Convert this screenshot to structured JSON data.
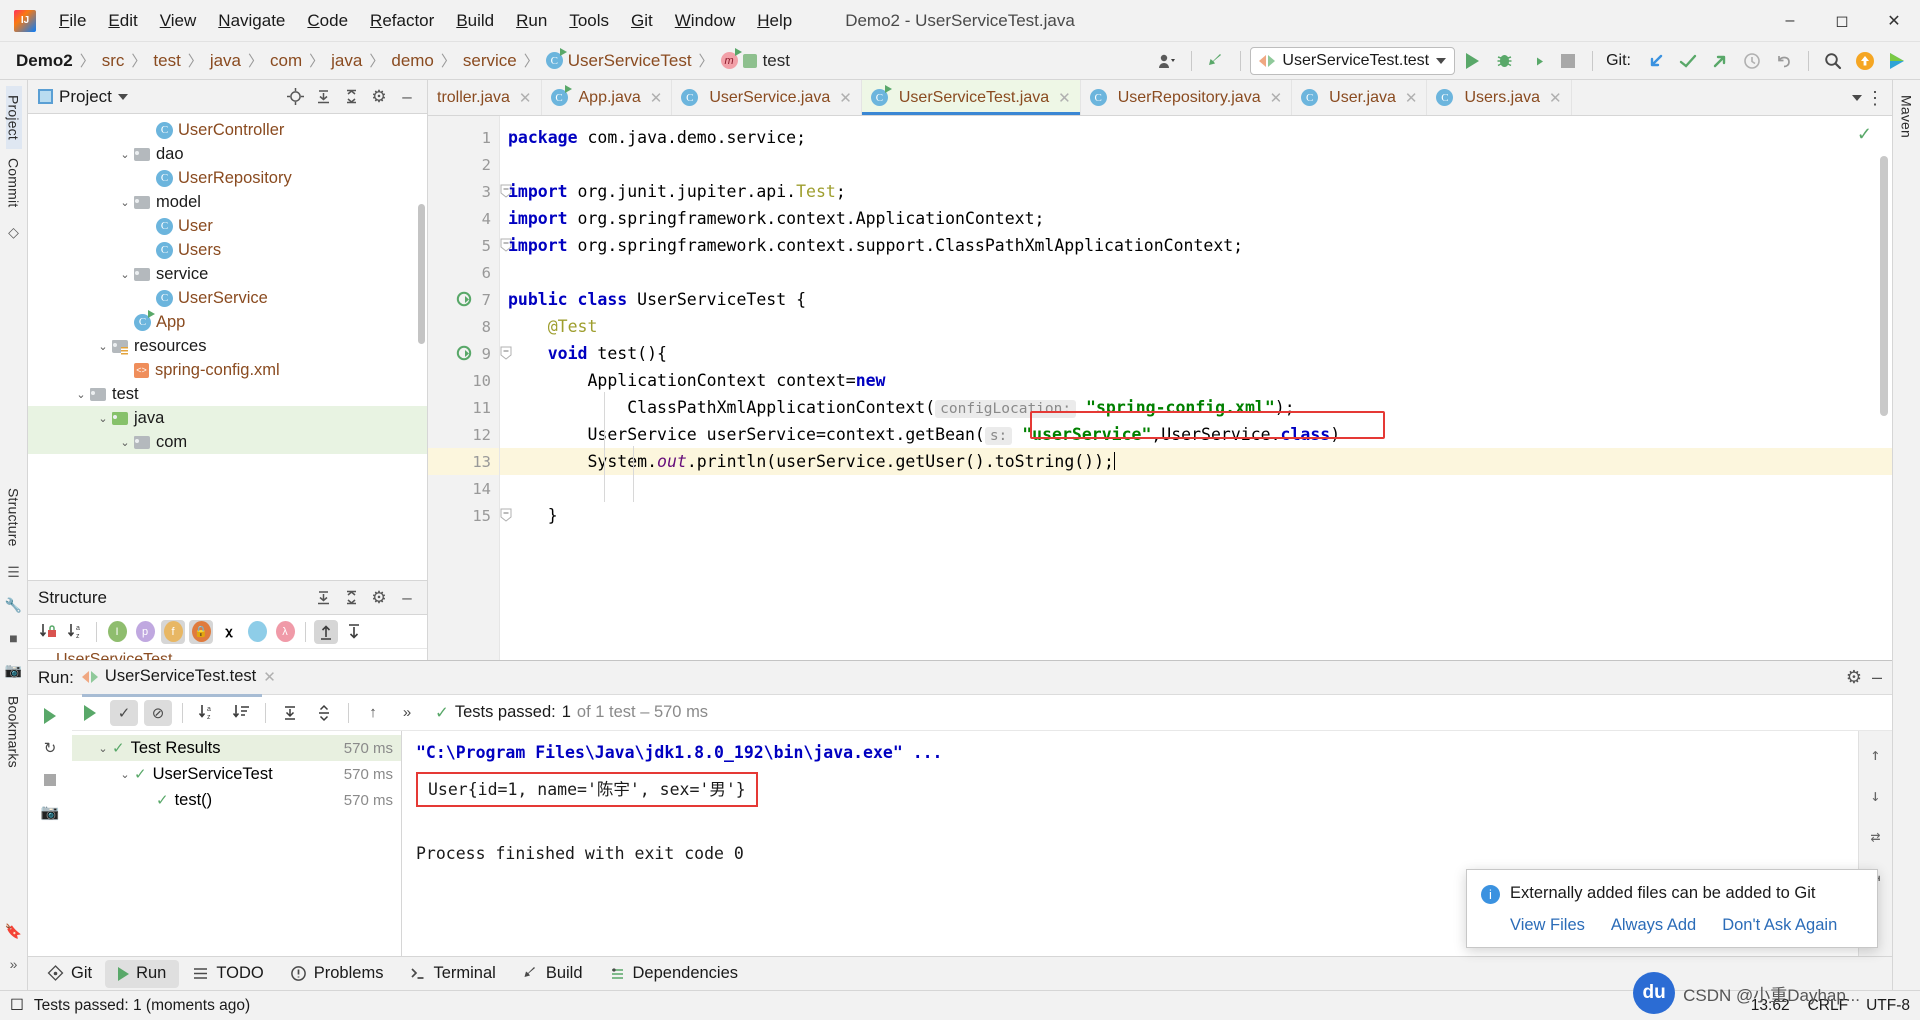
{
  "window": {
    "title": "Demo2 - UserServiceTest.java",
    "minimize": "─",
    "maximize": "☐",
    "close": "✕"
  },
  "menu": [
    "File",
    "Edit",
    "View",
    "Navigate",
    "Code",
    "Refactor",
    "Build",
    "Run",
    "Tools",
    "Git",
    "Window",
    "Help"
  ],
  "breadcrumb": [
    {
      "label": "Demo2",
      "style": "proj"
    },
    {
      "label": "src",
      "style": "plain"
    },
    {
      "label": "test",
      "style": "plain"
    },
    {
      "label": "java",
      "style": "plain"
    },
    {
      "label": "com",
      "style": "plain"
    },
    {
      "label": "java",
      "style": "plain"
    },
    {
      "label": "demo",
      "style": "plain"
    },
    {
      "label": "service",
      "style": "plain"
    },
    {
      "label": "UserServiceTest",
      "style": "class"
    },
    {
      "label": "test",
      "style": "method"
    }
  ],
  "toolbar": {
    "run_config": "UserServiceTest.test",
    "run_title": "Run",
    "debug_title": "Debug",
    "coverage_title": "Run with Coverage",
    "stop_title": "Stop",
    "git_label": "Git:",
    "update_title": "Update Project",
    "commit_title": "Commit",
    "push_title": "Push",
    "history_title": "History",
    "rollback_title": "Rollback",
    "search_title": "Search Everywhere",
    "profiler_title": "Profiler",
    "plugin_title": "Plugin"
  },
  "left_rail": {
    "items": [
      "Project",
      "Commit"
    ],
    "bottom_items": [
      "Structure",
      "Bookmarks"
    ]
  },
  "right_rail": {
    "items": [
      "Maven"
    ]
  },
  "project_panel": {
    "title": "Project",
    "tools": [
      "locate-icon",
      "expand-icon",
      "collapse-icon",
      "settings-icon",
      "hide-icon"
    ],
    "tree": [
      {
        "label": "UserController",
        "indent": 5,
        "type": "class",
        "expander": "",
        "selected": false
      },
      {
        "label": "dao",
        "indent": 4,
        "type": "folder",
        "expander": "⌄",
        "selected": false
      },
      {
        "label": "UserRepository",
        "indent": 5,
        "type": "class",
        "expander": "",
        "selected": false
      },
      {
        "label": "model",
        "indent": 4,
        "type": "folder",
        "expander": "⌄",
        "selected": false
      },
      {
        "label": "User",
        "indent": 5,
        "type": "class",
        "expander": "",
        "selected": false
      },
      {
        "label": "Users",
        "indent": 5,
        "type": "class",
        "expander": "",
        "selected": false
      },
      {
        "label": "service",
        "indent": 4,
        "type": "folder",
        "expander": "⌄",
        "selected": false
      },
      {
        "label": "UserService",
        "indent": 5,
        "type": "class",
        "expander": "",
        "selected": false
      },
      {
        "label": "App",
        "indent": 4,
        "type": "class-run",
        "expander": "",
        "selected": false
      },
      {
        "label": "resources",
        "indent": 3,
        "type": "folder-res",
        "expander": "⌄",
        "selected": false
      },
      {
        "label": "spring-config.xml",
        "indent": 4,
        "type": "xml",
        "expander": "",
        "selected": false
      },
      {
        "label": "test",
        "indent": 2,
        "type": "folder",
        "expander": "⌄",
        "selected": false
      },
      {
        "label": "java",
        "indent": 3,
        "type": "folder-green",
        "expander": "⌄",
        "selected": true
      },
      {
        "label": "com",
        "indent": 4,
        "type": "folder",
        "expander": "⌄",
        "selected": true
      }
    ]
  },
  "structure_panel": {
    "title": "Structure",
    "tools": [
      "sort-by-visibility-icon",
      "sort-alpha-icon",
      "inherited-icon",
      "properties-icon",
      "fields-icon",
      "non-public-icon",
      "anonymous-icon",
      "interface-icon",
      "lambda-icon",
      "expand-all-icon",
      "collapse-all-icon"
    ],
    "row": "UserServiceTest"
  },
  "editor": {
    "tabs": [
      {
        "label": "troller.java",
        "active": false,
        "truncated": true
      },
      {
        "label": "App.java",
        "active": false,
        "icon": "class-run"
      },
      {
        "label": "UserService.java",
        "active": false,
        "icon": "class"
      },
      {
        "label": "UserServiceTest.java",
        "active": true,
        "icon": "class-run"
      },
      {
        "label": "UserRepository.java",
        "active": false,
        "icon": "class"
      },
      {
        "label": "User.java",
        "active": false,
        "icon": "class"
      },
      {
        "label": "Users.java",
        "active": false,
        "icon": "class"
      }
    ],
    "line_numbers": [
      "1",
      "2",
      "3",
      "4",
      "5",
      "6",
      "7",
      "8",
      "9",
      "10",
      "11",
      "12",
      "13",
      "14",
      "15"
    ],
    "highlight_line": 13,
    "gutter_run_lines": [
      7,
      9
    ],
    "code_lines": [
      {
        "n": 1,
        "tokens": [
          {
            "t": "package ",
            "c": "kw"
          },
          {
            "t": "com.java.demo.service;",
            "c": ""
          }
        ]
      },
      {
        "n": 2,
        "tokens": []
      },
      {
        "n": 3,
        "tokens": [
          {
            "t": "import ",
            "c": "kw"
          },
          {
            "t": "org.junit.jupiter.api.",
            "c": ""
          },
          {
            "t": "Test",
            "c": "ann"
          },
          {
            "t": ";",
            "c": ""
          }
        ]
      },
      {
        "n": 4,
        "tokens": [
          {
            "t": "import ",
            "c": "kw"
          },
          {
            "t": "org.springframework.context.ApplicationContext;",
            "c": ""
          }
        ]
      },
      {
        "n": 5,
        "tokens": [
          {
            "t": "import ",
            "c": "kw"
          },
          {
            "t": "org.springframework.context.support.ClassPathXmlApplicationContext;",
            "c": ""
          }
        ]
      },
      {
        "n": 6,
        "tokens": []
      },
      {
        "n": 7,
        "tokens": [
          {
            "t": "public class ",
            "c": "kw"
          },
          {
            "t": "UserServiceTest {",
            "c": ""
          }
        ]
      },
      {
        "n": 8,
        "tokens": [
          {
            "t": "    @Test",
            "c": "ann"
          }
        ]
      },
      {
        "n": 9,
        "tokens": [
          {
            "t": "    ",
            "c": ""
          },
          {
            "t": "void",
            "c": "kw"
          },
          {
            "t": " test(){",
            "c": ""
          }
        ]
      },
      {
        "n": 10,
        "tokens": [
          {
            "t": "        ApplicationContext context=",
            "c": ""
          },
          {
            "t": "new",
            "c": "kw"
          }
        ]
      },
      {
        "n": 11,
        "tokens": [
          {
            "t": "            ClassPathXmlApplicationContext(",
            "c": ""
          },
          {
            "t": "configLocation:",
            "c": "hint"
          },
          {
            "t": " ",
            "c": ""
          },
          {
            "t": "\"spring-config.xml\"",
            "c": "str"
          },
          {
            "t": ");",
            "c": ""
          }
        ]
      },
      {
        "n": 12,
        "tokens": [
          {
            "t": "        UserService userService=context.getBean(",
            "c": ""
          },
          {
            "t": "s:",
            "c": "hint"
          },
          {
            "t": " ",
            "c": ""
          },
          {
            "t": "\"userService\"",
            "c": "str"
          },
          {
            "t": ",UserService.",
            "c": ""
          },
          {
            "t": "class",
            "c": "kw"
          },
          {
            "t": ")",
            "c": ""
          }
        ]
      },
      {
        "n": 13,
        "tokens": [
          {
            "t": "        System.",
            "c": ""
          },
          {
            "t": "out",
            "c": "fld"
          },
          {
            "t": ".println(userService.getUser().toString());",
            "c": ""
          }
        ]
      },
      {
        "n": 14,
        "tokens": []
      },
      {
        "n": 15,
        "tokens": [
          {
            "t": "    }",
            "c": ""
          }
        ]
      }
    ]
  },
  "run_panel": {
    "label": "Run:",
    "tab": "UserServiceTest.test",
    "toolbar_icons": [
      "rerun-icon",
      "show-passed-icon",
      "hide-ignored-icon",
      "sort-alpha-icon",
      "sort-duration-icon",
      "expand-all-icon",
      "collapse-all-icon",
      "prev-failed-icon",
      "more-icon"
    ],
    "summary": {
      "prefix": "Tests passed:",
      "count": "1",
      "suffix": "of 1 test – 570 ms"
    },
    "tests": [
      {
        "label": "Test Results",
        "duration": "570 ms",
        "indent": 1,
        "selected": true,
        "expander": "⌄"
      },
      {
        "label": "UserServiceTest",
        "duration": "570 ms",
        "indent": 2,
        "selected": false,
        "expander": "⌄"
      },
      {
        "label": "test()",
        "duration": "570 ms",
        "indent": 3,
        "selected": false,
        "expander": ""
      }
    ],
    "console": [
      {
        "text": "\"C:\\Program Files\\Java\\jdk1.8.0_192\\bin\\java.exe\" ...",
        "style": "cmd"
      },
      {
        "text": "User{id=1, name='陈宇', sex='男'}",
        "style": "boxed"
      },
      {
        "text": "",
        "style": ""
      },
      {
        "text": "Process finished with exit code 0",
        "style": "plain"
      }
    ],
    "side_icons": [
      "scroll-up-icon",
      "scroll-down-icon",
      "soft-wrap-icon",
      "print-icon"
    ]
  },
  "notification": {
    "message": "Externally added files can be added to Git",
    "links": [
      "View Files",
      "Always Add",
      "Don't Ask Again"
    ]
  },
  "bottom_bar": [
    {
      "label": "Git",
      "icon": "git-icon",
      "active": false
    },
    {
      "label": "Run",
      "icon": "run-icon",
      "active": true
    },
    {
      "label": "TODO",
      "icon": "todo-icon",
      "active": false
    },
    {
      "label": "Problems",
      "icon": "problems-icon",
      "active": false
    },
    {
      "label": "Terminal",
      "icon": "terminal-icon",
      "active": false
    },
    {
      "label": "Build",
      "icon": "build-icon",
      "active": false
    },
    {
      "label": "Dependencies",
      "icon": "dependencies-icon",
      "active": false
    }
  ],
  "status_bar": {
    "message": "Tests passed: 1 (moments ago)",
    "position": "13:62",
    "line_sep": "CRLF",
    "encoding": "UTF-8"
  },
  "watermark": {
    "logo": "du",
    "text": "CSDN @小重Dayhap..."
  },
  "colors": {
    "accent_blue": "#3a87d4",
    "green": "#59a869",
    "string_green": "#008000",
    "keyword_blue": "#0000c0",
    "red_box": "#e53935",
    "class_orange": "#8a4b20"
  }
}
